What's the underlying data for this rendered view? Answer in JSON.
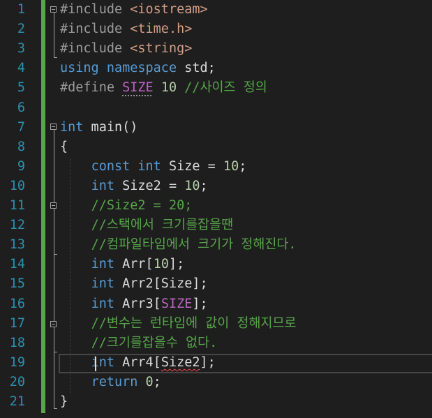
{
  "editor": {
    "line_numbers": [
      "1",
      "2",
      "3",
      "4",
      "5",
      "6",
      "7",
      "8",
      "9",
      "10",
      "11",
      "12",
      "13",
      "14",
      "15",
      "16",
      "17",
      "18",
      "19",
      "20",
      "21"
    ],
    "lines": [
      [
        {
          "t": "pp",
          "v": "#include "
        },
        {
          "t": "str",
          "v": "<iostream>"
        }
      ],
      [
        {
          "t": "pp",
          "v": "#include "
        },
        {
          "t": "str",
          "v": "<time.h>"
        }
      ],
      [
        {
          "t": "pp",
          "v": "#include "
        },
        {
          "t": "str",
          "v": "<string>"
        }
      ],
      [
        {
          "t": "kw",
          "v": "using"
        },
        {
          "t": "",
          "v": " "
        },
        {
          "t": "kw",
          "v": "namespace"
        },
        {
          "t": "",
          "v": " std;"
        }
      ],
      [
        {
          "t": "pp",
          "v": "#define "
        },
        {
          "t": "mac dots",
          "v": "SIZE"
        },
        {
          "t": "",
          "v": " "
        },
        {
          "t": "num",
          "v": "10"
        },
        {
          "t": "",
          "v": " "
        },
        {
          "t": "cm",
          "v": "//사이즈 정의"
        }
      ],
      [],
      [
        {
          "t": "kw",
          "v": "int"
        },
        {
          "t": "",
          "v": " main()"
        }
      ],
      [
        {
          "t": "",
          "v": "{"
        }
      ],
      [
        {
          "t": "",
          "v": "    "
        },
        {
          "t": "kw",
          "v": "const"
        },
        {
          "t": "",
          "v": " "
        },
        {
          "t": "kw",
          "v": "int"
        },
        {
          "t": "",
          "v": " Size = "
        },
        {
          "t": "num",
          "v": "10"
        },
        {
          "t": "",
          "v": ";"
        }
      ],
      [
        {
          "t": "",
          "v": "    "
        },
        {
          "t": "kw",
          "v": "int"
        },
        {
          "t": "",
          "v": " Size2 = "
        },
        {
          "t": "num",
          "v": "10"
        },
        {
          "t": "",
          "v": ";"
        }
      ],
      [
        {
          "t": "",
          "v": "    "
        },
        {
          "t": "cm",
          "v": "//Size2 = 20;"
        }
      ],
      [
        {
          "t": "",
          "v": "    "
        },
        {
          "t": "cm",
          "v": "//스택에서 크기를잡을땐"
        }
      ],
      [
        {
          "t": "",
          "v": "    "
        },
        {
          "t": "cm",
          "v": "//컴파일타임에서 크기가 정해진다."
        }
      ],
      [
        {
          "t": "",
          "v": "    "
        },
        {
          "t": "kw",
          "v": "int"
        },
        {
          "t": "",
          "v": " Arr["
        },
        {
          "t": "num",
          "v": "10"
        },
        {
          "t": "",
          "v": "];"
        }
      ],
      [
        {
          "t": "",
          "v": "    "
        },
        {
          "t": "kw",
          "v": "int"
        },
        {
          "t": "",
          "v": " Arr2[Size];"
        }
      ],
      [
        {
          "t": "",
          "v": "    "
        },
        {
          "t": "kw",
          "v": "int"
        },
        {
          "t": "",
          "v": " Arr3["
        },
        {
          "t": "mac",
          "v": "SIZE"
        },
        {
          "t": "",
          "v": "];"
        }
      ],
      [
        {
          "t": "",
          "v": "    "
        },
        {
          "t": "cm",
          "v": "//변수는 런타임에 값이 정해지므로"
        }
      ],
      [
        {
          "t": "",
          "v": "    "
        },
        {
          "t": "cm",
          "v": "//크기를잡을수 없다."
        }
      ],
      [
        {
          "t": "",
          "v": "    "
        },
        {
          "t": "kw",
          "v": "int"
        },
        {
          "t": "",
          "v": " Arr4["
        },
        {
          "t": "squiggle",
          "v": "Size2"
        },
        {
          "t": "",
          "v": "];"
        }
      ],
      [
        {
          "t": "",
          "v": "    "
        },
        {
          "t": "kw",
          "v": "return"
        },
        {
          "t": "",
          "v": " "
        },
        {
          "t": "num",
          "v": "0"
        },
        {
          "t": "",
          "v": ";"
        }
      ],
      [
        {
          "t": "",
          "v": "}"
        }
      ]
    ]
  },
  "colors": {
    "background": "#1e1e1e",
    "line_number": "#2b91af",
    "keyword": "#569cd6",
    "preprocessor": "#9b9b9b",
    "string": "#d69d85",
    "number": "#b5cea8",
    "macro": "#bd63c5",
    "comment": "#57a64a",
    "text": "#dcdcdc",
    "change_bar": "#57a64a"
  }
}
